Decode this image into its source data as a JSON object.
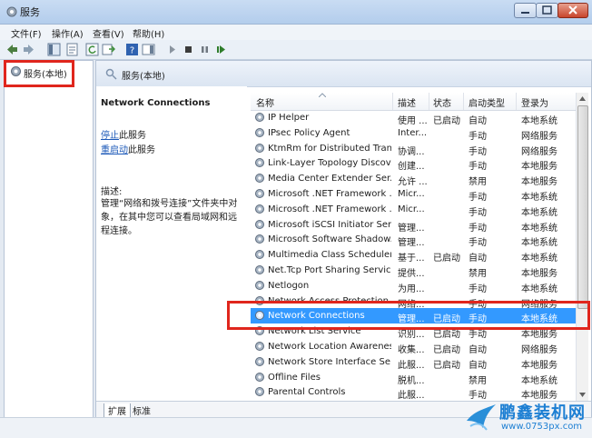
{
  "window": {
    "title": "服务"
  },
  "menu": [
    "文件(F)",
    "操作(A)",
    "查看(V)",
    "帮助(H)"
  ],
  "tree": {
    "root": "服务(本地)"
  },
  "panel": {
    "header": "服务(本地)"
  },
  "selected_service": {
    "name": "Network Connections",
    "stop_link": "停止",
    "stop_suffix": "此服务",
    "restart_link": "重启动",
    "restart_suffix": "此服务",
    "desc_label": "描述:",
    "desc_text": "管理“网络和拨号连接”文件夹中对象，在其中您可以查看局域网和远程连接。"
  },
  "table": {
    "columns": [
      "名称",
      "描述",
      "状态",
      "启动类型",
      "登录为"
    ],
    "rows": [
      {
        "name": "IP Helper",
        "desc": "使用 ...",
        "status": "已启动",
        "startup": "自动",
        "logon": "本地系统"
      },
      {
        "name": "IPsec Policy Agent",
        "desc": "Inter...",
        "status": "",
        "startup": "手动",
        "logon": "网络服务"
      },
      {
        "name": "KtmRm for Distributed Tran...",
        "desc": "协调...",
        "status": "",
        "startup": "手动",
        "logon": "网络服务"
      },
      {
        "name": "Link-Layer Topology Discov...",
        "desc": "创建...",
        "status": "",
        "startup": "手动",
        "logon": "本地服务"
      },
      {
        "name": "Media Center Extender Ser...",
        "desc": "允许 ...",
        "status": "",
        "startup": "禁用",
        "logon": "本地服务"
      },
      {
        "name": "Microsoft .NET Framework ...",
        "desc": "Micr...",
        "status": "",
        "startup": "手动",
        "logon": "本地系统"
      },
      {
        "name": "Microsoft .NET Framework ...",
        "desc": "Micr...",
        "status": "",
        "startup": "手动",
        "logon": "本地系统"
      },
      {
        "name": "Microsoft iSCSI Initiator Ser...",
        "desc": "管理...",
        "status": "",
        "startup": "手动",
        "logon": "本地系统"
      },
      {
        "name": "Microsoft Software Shadow...",
        "desc": "管理...",
        "status": "",
        "startup": "手动",
        "logon": "本地系统"
      },
      {
        "name": "Multimedia Class Scheduler",
        "desc": "基于...",
        "status": "已启动",
        "startup": "自动",
        "logon": "本地系统"
      },
      {
        "name": "Net.Tcp Port Sharing Service",
        "desc": "提供...",
        "status": "",
        "startup": "禁用",
        "logon": "本地服务"
      },
      {
        "name": "Netlogon",
        "desc": "为用...",
        "status": "",
        "startup": "手动",
        "logon": "本地系统"
      },
      {
        "name": "Network Access Protection ...",
        "desc": "网络...",
        "status": "",
        "startup": "手动",
        "logon": "网络服务"
      },
      {
        "name": "Network Connections",
        "desc": "管理...",
        "status": "已启动",
        "startup": "手动",
        "logon": "本地系统"
      },
      {
        "name": "Network List Service",
        "desc": "识别...",
        "status": "已启动",
        "startup": "手动",
        "logon": "本地服务"
      },
      {
        "name": "Network Location Awareness",
        "desc": "收集...",
        "status": "已启动",
        "startup": "自动",
        "logon": "网络服务"
      },
      {
        "name": "Network Store Interface Se...",
        "desc": "此服...",
        "status": "已启动",
        "startup": "自动",
        "logon": "本地服务"
      },
      {
        "name": "Offline Files",
        "desc": "脱机...",
        "status": "",
        "startup": "禁用",
        "logon": "本地系统"
      },
      {
        "name": "Parental Controls",
        "desc": "此服...",
        "status": "",
        "startup": "手动",
        "logon": "本地服务"
      }
    ],
    "selected_index": 13
  },
  "tabs": [
    "扩展",
    "标准"
  ],
  "watermark": {
    "brand": "鹏鑫装机网",
    "url": "www.0753px.com"
  },
  "colors": {
    "selection": "#3399ff",
    "highlight_box": "#e0261d",
    "link": "#1b58b8"
  }
}
